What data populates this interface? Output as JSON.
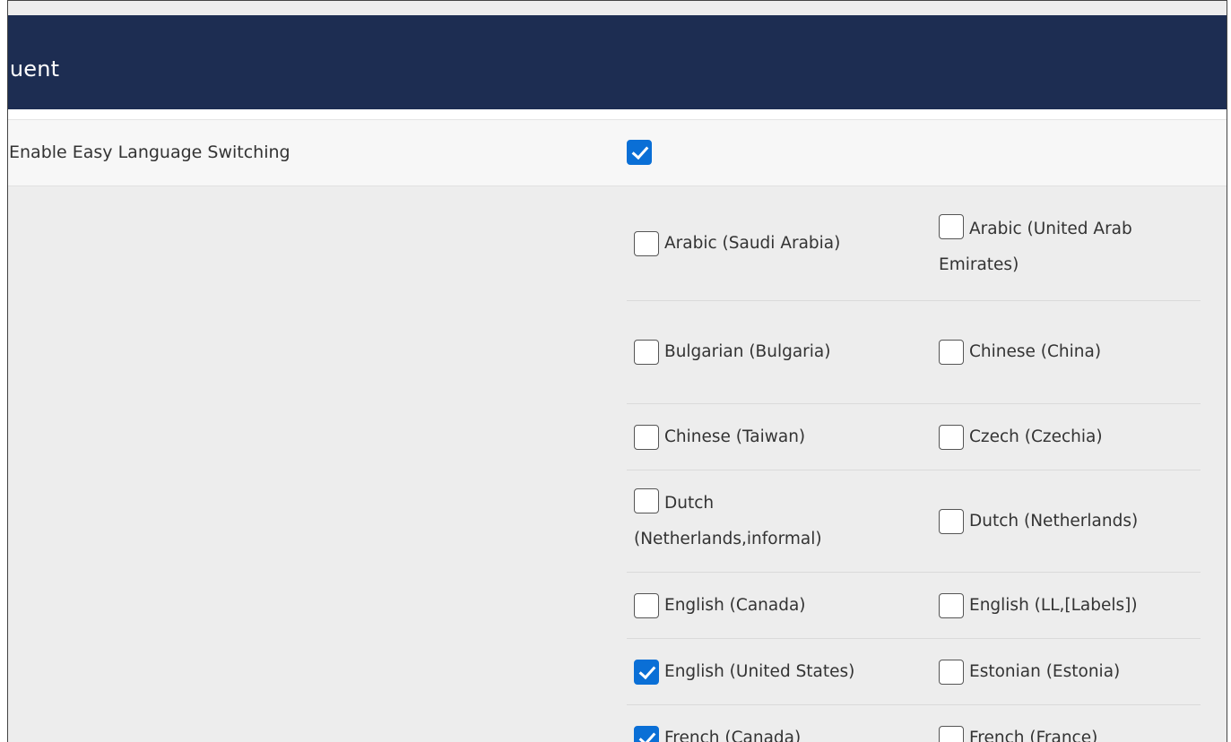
{
  "header": {
    "title": "luent"
  },
  "easy_switch": {
    "label": "Enable Easy Language Switching",
    "checked": true
  },
  "languages": [
    [
      {
        "label": "Arabic (Saudi Arabia)",
        "checked": false
      },
      {
        "label": "Arabic (United Arab Emirates)",
        "label_line1": "Arabic (United Arab",
        "label_line2": "Emirates)",
        "checked": false
      }
    ],
    [
      {
        "label": "Bulgarian (Bulgaria)",
        "checked": false
      },
      {
        "label": "Chinese (China)",
        "checked": false
      }
    ],
    [
      {
        "label": "Chinese (Taiwan)",
        "checked": false
      },
      {
        "label": "Czech (Czechia)",
        "checked": false
      }
    ],
    [
      {
        "label": "Dutch (Netherlands,informal)",
        "label_line1": "Dutch",
        "label_line2": "(Netherlands,informal)",
        "checked": false
      },
      {
        "label": "Dutch (Netherlands)",
        "checked": false
      }
    ],
    [
      {
        "label": "English (Canada)",
        "checked": false
      },
      {
        "label": "English (LL,[Labels])",
        "checked": false
      }
    ],
    [
      {
        "label": "English (United States)",
        "checked": true
      },
      {
        "label": "Estonian (Estonia)",
        "checked": false
      }
    ],
    [
      {
        "label": "French (Canada)",
        "checked": true
      },
      {
        "label": "French (France)",
        "checked": false
      }
    ]
  ]
}
